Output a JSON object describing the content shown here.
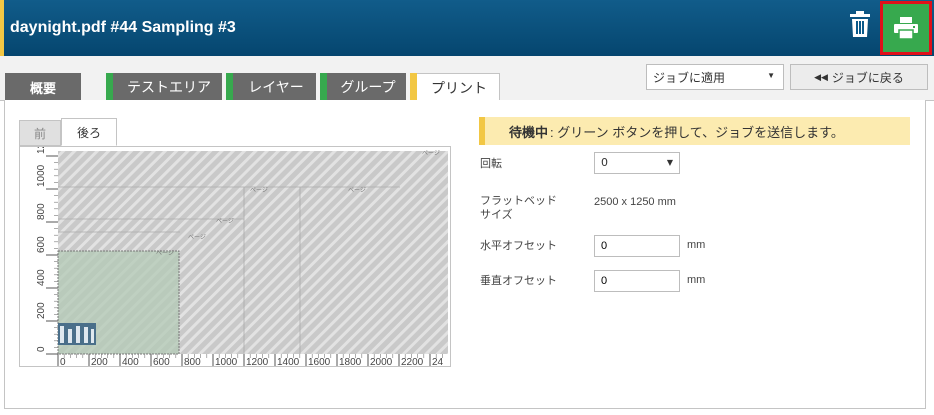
{
  "header": {
    "title": "daynight.pdf #44 Sampling #3"
  },
  "tabs": {
    "overview": "概要",
    "test_area": "テストエリア",
    "layer": "レイヤー",
    "group": "グループ",
    "print": "プリント"
  },
  "toolbar": {
    "apply_select": "ジョブに適用",
    "back_label": "ジョブに戻る"
  },
  "preview": {
    "front_tab": "前",
    "back_tab": "後ろ",
    "x_ticks": [
      "0",
      "200",
      "400",
      "600",
      "800",
      "1000",
      "1200",
      "1400",
      "1600",
      "1800",
      "2000",
      "2200",
      "24"
    ],
    "y_ticks": [
      "0",
      "200",
      "400",
      "600",
      "800",
      "1000",
      "1200"
    ],
    "page_labels": [
      "ページ",
      "ページ",
      "ページ",
      "ページ",
      "ページ",
      "ページ"
    ]
  },
  "notice": {
    "status": "待機中",
    "message": ": グリーン ボタンを押して、ジョブを送信します。"
  },
  "form": {
    "rotation_label": "回転",
    "rotation_value": "0",
    "flatbed_label_1": "フラットベッド",
    "flatbed_label_2": "サイズ",
    "flatbed_value": "2500 x 1250 mm",
    "h_offset_label": "水平オフセット",
    "h_offset_value": "0",
    "h_offset_unit": "mm",
    "v_offset_label": "垂直オフセット",
    "v_offset_value": "0",
    "v_offset_unit": "mm"
  },
  "colors": {
    "header": "#0a5a8a",
    "accent_yellow": "#f2c744",
    "green": "#37a94e",
    "tab_gray": "#6a6a6a",
    "highlight_red": "#e0101a"
  }
}
